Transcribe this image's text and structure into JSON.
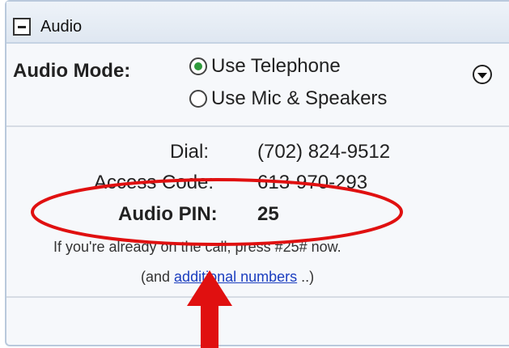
{
  "panel": {
    "title": "Audio",
    "mode_label": "Audio Mode:",
    "options": [
      {
        "label": "Use Telephone",
        "selected": true
      },
      {
        "label": "Use Mic & Speakers",
        "selected": false
      }
    ]
  },
  "dialin": {
    "dial_label": "Dial:",
    "dial_number": "(702) 824-9512",
    "access_label": "Access Code:",
    "access_code": "613-970-293",
    "pin_label": "Audio PIN:",
    "pin_value": "25",
    "note": "If you're already on the call, press #25# now.",
    "more_prefix": "(and",
    "more_link": "additional numbers",
    "more_suffix": "..)"
  },
  "annotation": {
    "ellipse_color": "#e01010",
    "arrow_color": "#e01010"
  }
}
